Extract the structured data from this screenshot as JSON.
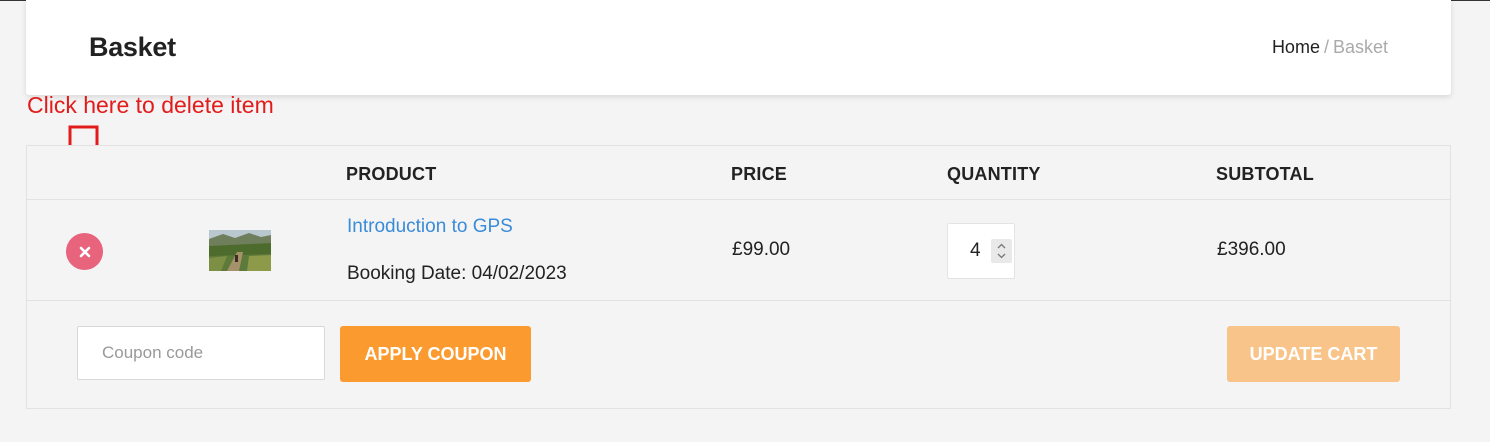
{
  "header": {
    "title": "Basket",
    "breadcrumb": {
      "home": "Home",
      "separator": "/",
      "current": "Basket"
    }
  },
  "annotation": {
    "text": "Click here to delete item",
    "color": "#e21b1b"
  },
  "table": {
    "columns": [
      "PRODUCT",
      "PRICE",
      "QUANTITY",
      "SUBTOTAL"
    ],
    "items": [
      {
        "product": "Introduction to GPS",
        "booking_label": "Booking Date:",
        "booking_date": "04/02/2023",
        "price": "£99.00",
        "quantity": "4",
        "subtotal": "£396.00",
        "thumbnail": "hiking-trail-photo"
      }
    ]
  },
  "actions": {
    "coupon_placeholder": "Coupon code",
    "apply_label": "APPLY COUPON",
    "update_label": "UPDATE CART"
  },
  "colors": {
    "accent_link": "#3a8bd8",
    "apply_button": "#fb9b2f",
    "update_button_disabled": "#f9c48a",
    "remove_button": "#e8637c"
  }
}
